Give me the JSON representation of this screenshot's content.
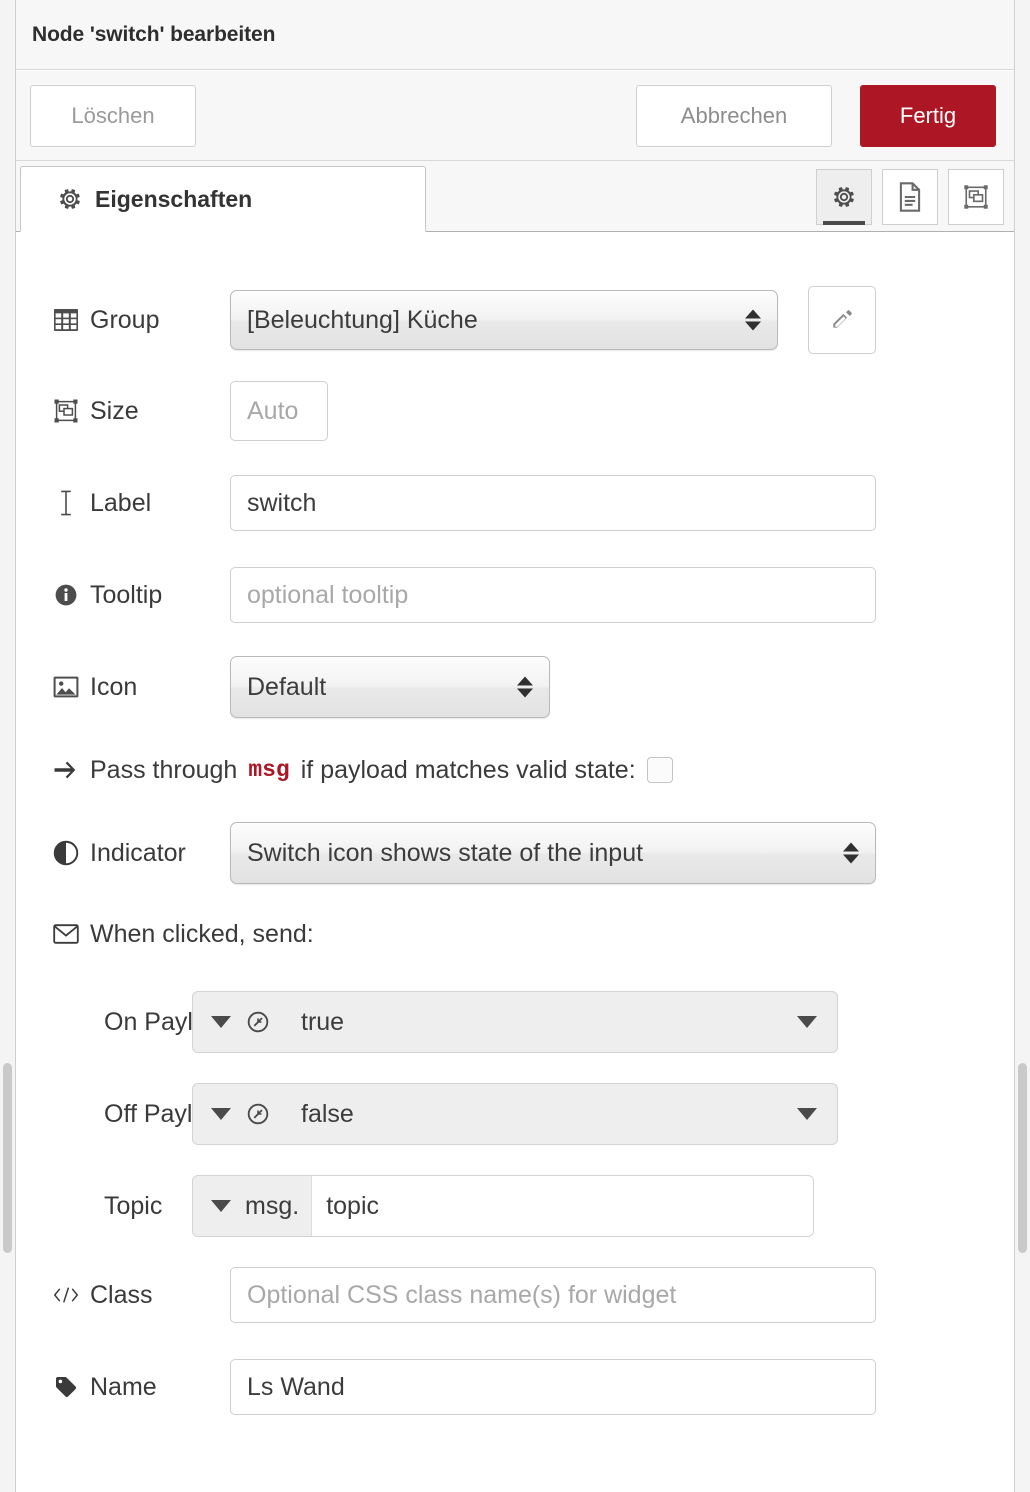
{
  "dialog": {
    "title": "Node 'switch' bearbeiten"
  },
  "buttons": {
    "delete": "Löschen",
    "cancel": "Abbrechen",
    "done": "Fertig"
  },
  "tabs": {
    "properties": {
      "label": "Eigenschaften",
      "icon": "gear-icon"
    },
    "icon_buttons": [
      {
        "name": "properties-tab-icon",
        "icon": "gear-icon",
        "active": true
      },
      {
        "name": "description-tab-icon",
        "icon": "document-icon",
        "active": false
      },
      {
        "name": "appearance-tab-icon",
        "icon": "appearance-icon",
        "active": false
      }
    ]
  },
  "form": {
    "group": {
      "label": "Group",
      "icon": "table-icon",
      "value": "[Beleuchtung] Küche",
      "edit_button_icon": "pencil-icon"
    },
    "size": {
      "label": "Size",
      "icon": "object-group-icon",
      "value": "Auto"
    },
    "label_field": {
      "label": "Label",
      "icon": "text-cursor-icon",
      "value": "switch"
    },
    "tooltip": {
      "label": "Tooltip",
      "icon": "info-circle-icon",
      "value": "",
      "placeholder": "optional tooltip"
    },
    "icon_field": {
      "label": "Icon",
      "icon": "image-icon",
      "value": "Default"
    },
    "passthrough": {
      "icon": "arrow-right-icon",
      "text_before": "Pass through",
      "code": "msg",
      "text_after": "if payload matches valid state:",
      "checked": false
    },
    "indicator": {
      "label": "Indicator",
      "icon": "adjust-circle-icon",
      "value": "Switch icon shows state of the input"
    },
    "when_clicked": {
      "icon": "envelope-icon",
      "label": "When clicked, send:"
    },
    "on_payload": {
      "label": "On Payload",
      "type_icon": "boolean-type-icon",
      "value": "true"
    },
    "off_payload": {
      "label": "Off Payload",
      "type_icon": "boolean-type-icon",
      "value": "false"
    },
    "topic": {
      "label": "Topic",
      "prefix": "msg.",
      "value": "topic"
    },
    "class_field": {
      "label": "Class",
      "icon": "code-icon",
      "value": "",
      "placeholder": "Optional CSS class name(s) for widget"
    },
    "name_field": {
      "label": "Name",
      "icon": "tag-icon",
      "value": "Ls Wand"
    }
  },
  "colors": {
    "brand_red": "#ad1625",
    "header_bg": "#f7f7f7",
    "text": "#3a3a3a",
    "placeholder": "#a8a8a8"
  }
}
